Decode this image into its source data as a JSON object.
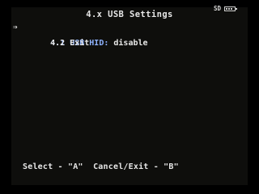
{
  "header": {
    "title": "4.x USB Settings",
    "storage_label": "SD",
    "battery_icon": "battery-icon"
  },
  "menu": {
    "cursor": "⇒",
    "items": [
      {
        "label": "4.1 USB HID:",
        "value": " disable",
        "selected": true
      },
      {
        "label": "4.2 Exit",
        "value": "",
        "selected": false
      }
    ]
  },
  "footer": {
    "hint": "Select - \"A\"  Cancel/Exit - \"B\""
  },
  "colors": {
    "background": "#000000",
    "text": "#e8e8e8",
    "selected": "#8fb3ff"
  }
}
